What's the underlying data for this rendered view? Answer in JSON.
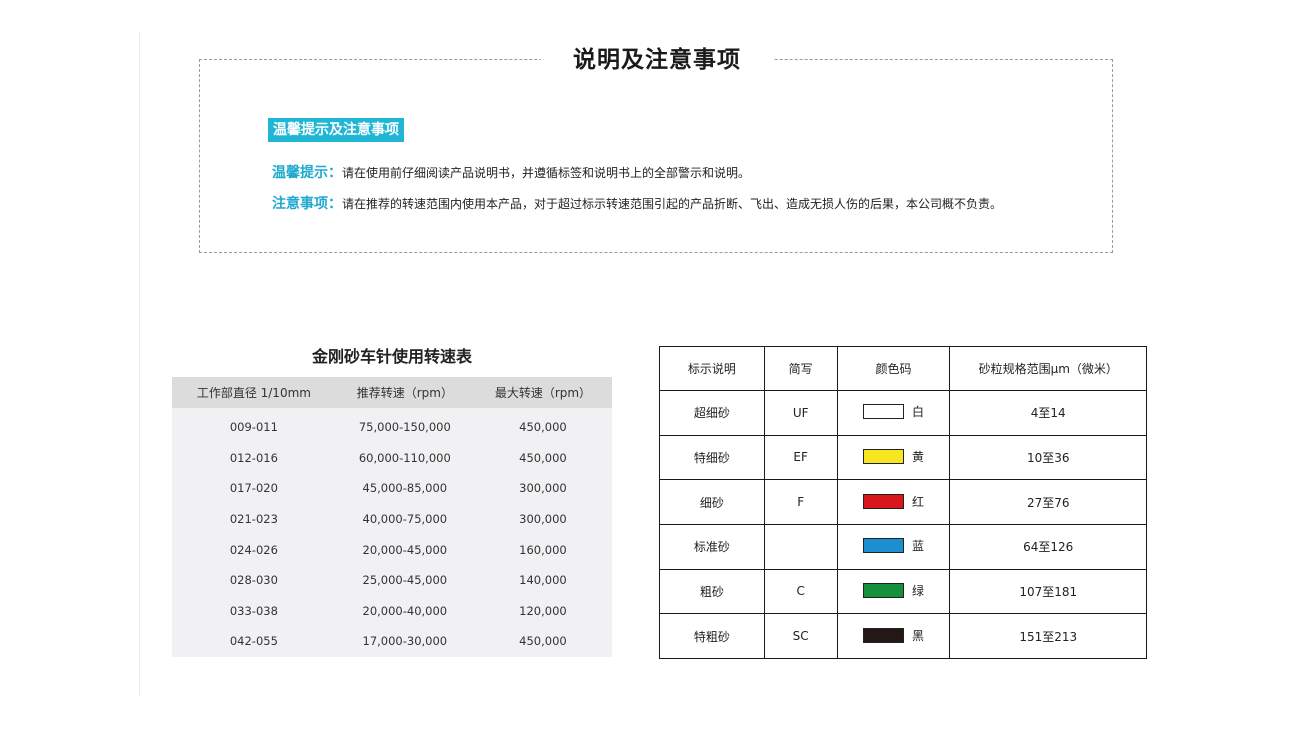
{
  "notice": {
    "title": "说明及注意事项",
    "banner": "温馨提示及注意事项",
    "tip_label": "温馨提示：",
    "tip_text": "请在使用前仔细阅读产品说明书，并遵循标签和说明书上的全部警示和说明。",
    "caution_label": "注意事项：",
    "caution_text": "请在推荐的转速范围内使用本产品，对于超过标示转速范围引起的产品折断、飞出、造成无损人伤的后果，本公司概不负责。"
  },
  "speed_table": {
    "title": "金刚砂车针使用转速表",
    "headers": [
      "工作部直径 1/10mm",
      "推荐转速（rpm）",
      "最大转速（rpm）"
    ],
    "rows": [
      [
        "009-011",
        "75,000-150,000",
        "450,000"
      ],
      [
        "012-016",
        "60,000-110,000",
        "450,000"
      ],
      [
        "017-020",
        "45,000-85,000",
        "300,000"
      ],
      [
        "021-023",
        "40,000-75,000",
        "300,000"
      ],
      [
        "024-026",
        "20,000-45,000",
        "160,000"
      ],
      [
        "028-030",
        "25,000-45,000",
        "140,000"
      ],
      [
        "033-038",
        "20,000-40,000",
        "120,000"
      ],
      [
        "042-055",
        "17,000-30,000",
        "450,000"
      ]
    ]
  },
  "grit_table": {
    "headers": [
      "标示说明",
      "简写",
      "颜色码",
      "砂粒规格范围μm（微米）"
    ],
    "rows": [
      {
        "name": "超细砂",
        "abbr": "UF",
        "color_name": "白",
        "color": "#ffffff",
        "range": "4至14"
      },
      {
        "name": "特细砂",
        "abbr": "EF",
        "color_name": "黄",
        "color": "#f5e620",
        "range": "10至36"
      },
      {
        "name": "细砂",
        "abbr": "F",
        "color_name": "红",
        "color": "#d9161c",
        "range": "27至76"
      },
      {
        "name": "标准砂",
        "abbr": "",
        "color_name": "蓝",
        "color": "#1d8fd0",
        "range": "64至126"
      },
      {
        "name": "粗砂",
        "abbr": "C",
        "color_name": "绿",
        "color": "#14913a",
        "range": "107至181"
      },
      {
        "name": "特粗砂",
        "abbr": "SC",
        "color_name": "黑",
        "color": "#231815",
        "range": "151至213"
      }
    ]
  }
}
